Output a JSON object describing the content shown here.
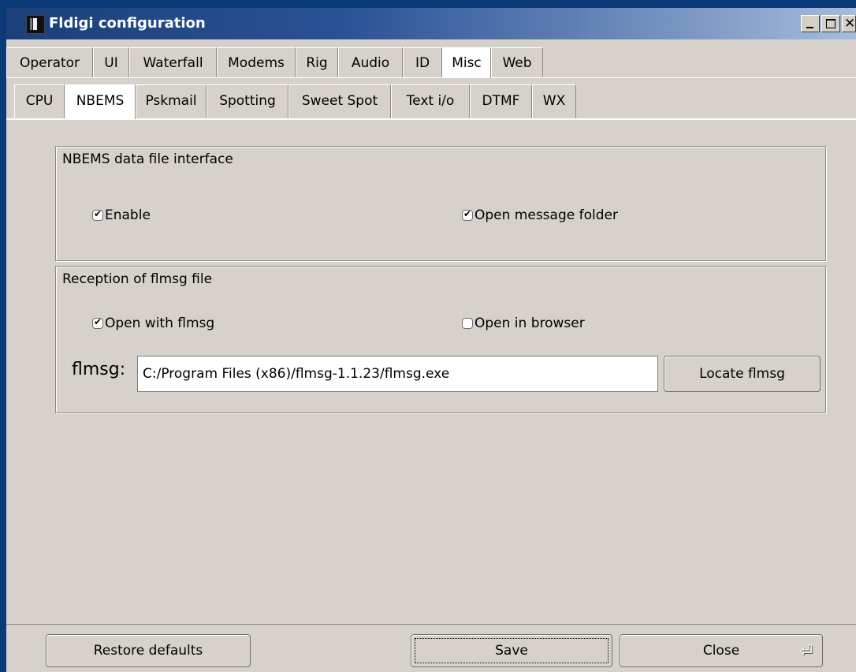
{
  "window": {
    "title": "Fldigi configuration"
  },
  "main_tabs": [
    "Operator",
    "UI",
    "Waterfall",
    "Modems",
    "Rig",
    "Audio",
    "ID",
    "Misc",
    "Web"
  ],
  "main_tabs_active": "Misc",
  "sub_tabs": [
    "CPU",
    "NBEMS",
    "Pskmail",
    "Spotting",
    "Sweet Spot",
    "Text i/o",
    "DTMF",
    "WX"
  ],
  "sub_tabs_active": "NBEMS",
  "nbems_group": {
    "label": "NBEMS data file interface",
    "enable": {
      "label": "Enable",
      "checked": true
    },
    "open_folder": {
      "label": "Open message folder",
      "checked": true
    }
  },
  "reception_group": {
    "label": "Reception of flmsg file",
    "open_flmsg": {
      "label": "Open with flmsg",
      "checked": true
    },
    "open_browser": {
      "label": "Open in browser",
      "checked": false
    },
    "path_label": "flmsg:",
    "path_value": "C:/Program Files (x86)/flmsg-1.1.23/flmsg.exe",
    "locate_label": "Locate flmsg"
  },
  "footer": {
    "restore_label": "Restore defaults",
    "save_label": "Save",
    "close_label": "Close"
  }
}
